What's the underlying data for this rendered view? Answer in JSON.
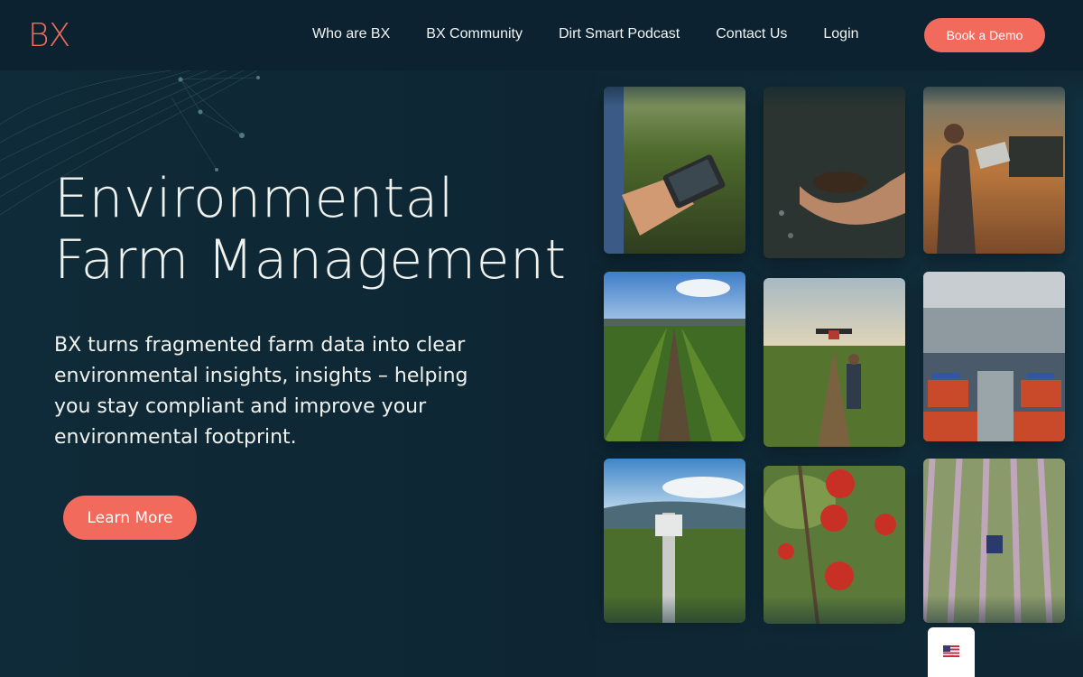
{
  "brand": {
    "logo": "BX",
    "accent": "#f26a5b",
    "background": "#0f2735"
  },
  "nav": {
    "items": [
      "Who are BX",
      "BX Community",
      "Dirt Smart Podcast",
      "Contact Us",
      "Login"
    ],
    "cta": "Book a Demo"
  },
  "hero": {
    "title_line1": "Environmental",
    "title_line2": "Farm Management",
    "subtitle": "BX turns fragmented farm data into clear environmental insights, insights – helping you stay compliant and improve your environmental footprint.",
    "button": "Learn More"
  },
  "gallery": [
    "tablet-in-vineyard-photo",
    "hands-holding-soil-photo",
    "farmer-with-laptop-sunset-photo",
    "vineyard-rows-photo",
    "drone-over-vineyard-photo",
    "fruit-packing-facility-photo",
    "weather-station-vineyard-photo",
    "red-apples-on-tree-photo",
    "orchard-aerial-tractor-photo"
  ],
  "language": {
    "icon": "us-flag-icon"
  }
}
